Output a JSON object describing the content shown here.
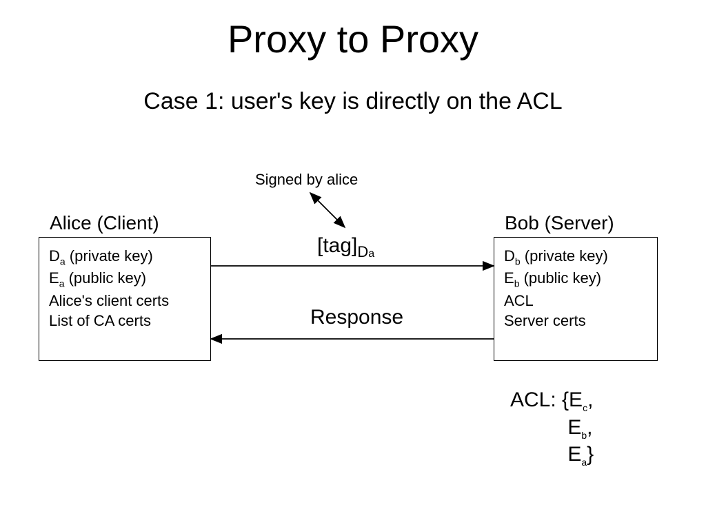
{
  "title": "Proxy to Proxy",
  "subtitle": "Case 1: user's key is directly on the ACL",
  "signed_label": "Signed by alice",
  "alice": {
    "title": "Alice (Client)",
    "lines_html": "D<span class='sub'>a</span> (private key)<br>E<span class='sub'>a</span> (public key)<br>Alice's client certs<br>List of CA certs"
  },
  "bob": {
    "title": "Bob (Server)",
    "lines_html": "D<span class='sub'>b</span> (private key)<br>E<span class='sub'>b</span> (public key)<br>ACL<br>Server certs"
  },
  "message_tag_html": "[tag]<span style='font-size:22px;vertical-align:sub'>D</span><span style='font-size:16px;vertical-align:sub'>a</span>",
  "message_response": "Response",
  "acl_html": "ACL: {E<span class='sub'>c</span>,\n          E<span class='sub'>b</span>,\n          E<span class='sub'>a</span>}"
}
